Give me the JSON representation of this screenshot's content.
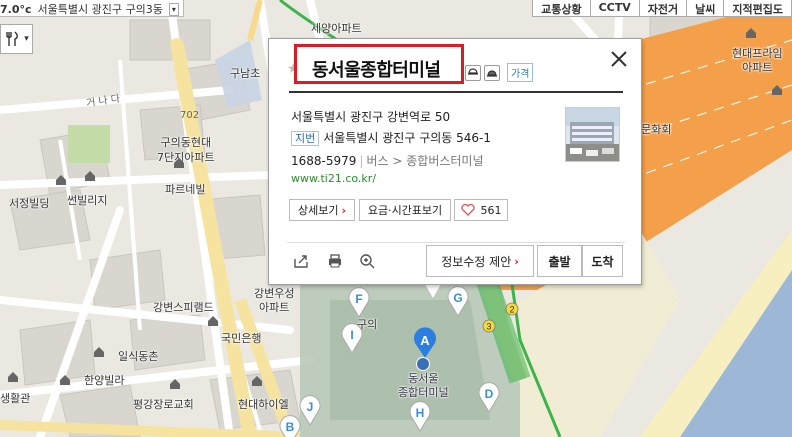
{
  "weather": {
    "temp": "7.0°c",
    "location": "서울특별시 광진구 구의3동",
    "dropdown": "▾"
  },
  "toolbar": [
    "교통상황",
    "CCTV",
    "자전거",
    "날씨",
    "지적편집도"
  ],
  "filter": {
    "icon": "fork-knife-icon",
    "dropdown": "▾"
  },
  "map_labels": {
    "seoul_apt": "세양아파트",
    "guyeong": "구남초",
    "gatnado": "거 나 다",
    "num702": "702",
    "guui_hyundai": "구의동현대\n7단지아파트",
    "parenel": "파르네빌",
    "seojeong": "서정빌딩",
    "sunbil": "썬빌리지",
    "gangbyeon_woosung": "강변우성\n아파트",
    "gangbyeon_pyramid": "강변스피램드",
    "kookmin": "국민은행",
    "ilsik": "일식동촌",
    "hanyang": "한양빌라",
    "pyeonggang": "평강장로교회",
    "saenghwal": "생활관",
    "hyundai_hiel": "현대하이엘",
    "dongseoul_term": "동서울\n종합터미널",
    "hyundai_prime": "현대프라임\n아파트",
    "munhwahoe": "문화회",
    "road_num": "3",
    "road_num2": "2",
    "guui_lbl": "구의"
  },
  "pins": [
    {
      "letter": "F",
      "color": "#3b8ed8"
    },
    {
      "letter": "I",
      "color": "#3b8ed8"
    },
    {
      "letter": "A",
      "color": "#2c7fe0"
    },
    {
      "letter": "D",
      "color": "#3b8ed8"
    },
    {
      "letter": "H",
      "color": "#3b8ed8"
    },
    {
      "letter": "J",
      "color": "#3b8ed8"
    },
    {
      "letter": "B",
      "color": "#3b8ed8"
    },
    {
      "letter": "G",
      "color": "#3b8ed8"
    }
  ],
  "popup": {
    "title": "동서울종합터미널",
    "price_tag": "가격",
    "address_road": "서울특별시 광진구 강변역로 50",
    "address_tag": "지번",
    "address_lot": "서울특별시 광진구 구의동 546-1",
    "phone": "1688-5979",
    "category": "버스 > 종합버스터미널",
    "url": "www.ti21.co.kr/",
    "detail_btn": "상세보기",
    "fare_btn": "요금·시간표보기",
    "like_count": "561",
    "edit_btn": "정보수정 제안",
    "depart_btn": "출발",
    "arrive_btn": "도착",
    "icons": {
      "share": "share-icon",
      "print": "print-icon",
      "zoom": "zoom-icon",
      "close": "close-icon",
      "heart": "heart-icon",
      "star": "star-icon"
    }
  },
  "colors": {
    "highlight_border": "#e01a22",
    "river": "#9db8d6",
    "orange_road": "#f4a04a",
    "green_line": "#3cb44b"
  }
}
